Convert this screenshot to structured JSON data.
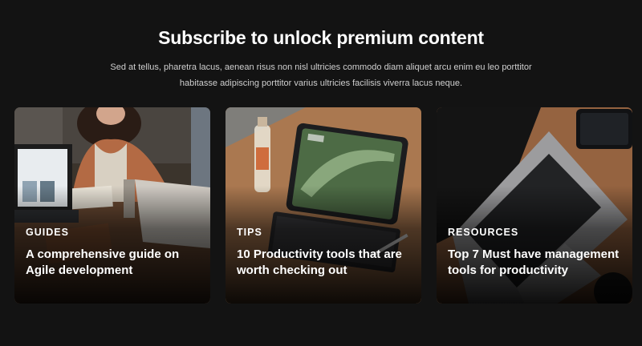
{
  "hero": {
    "title": "Subscribe to unlock premium content",
    "description": "Sed at tellus, pharetra lacus, aenean risus non nisl ultricies commodo diam aliquet arcu enim eu leo porttitor habitasse adipiscing porttitor varius ultricies facilisis viverra lacus neque."
  },
  "cards": [
    {
      "category": "GUIDES",
      "title": "A comprehensive guide on Agile development"
    },
    {
      "category": "TIPS",
      "title": "10 Productivity tools that are worth checking out"
    },
    {
      "category": "RESOURCES",
      "title": "Top 7 Must have management tools for productivity"
    }
  ],
  "colors": {
    "page_background": "#131313",
    "heading_text": "#ffffff",
    "body_text": "#cfcfcf"
  }
}
